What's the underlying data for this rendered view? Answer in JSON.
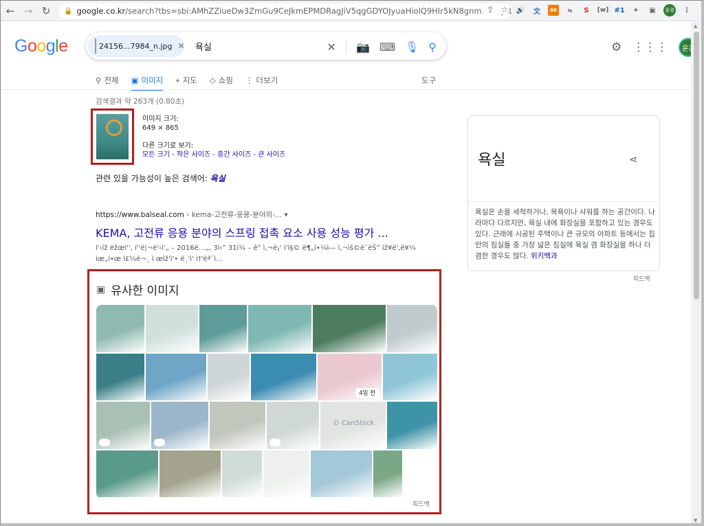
{
  "browser": {
    "url_host": "google.co.kr",
    "url_rest": "/search?tbs=sbi:AMhZZiueDw3ZmGu9CeJkmEPMDRagJiV5qgGDYOJyuaHiolQ9HIr5kN8gnmXxlFtJhLUwG5...",
    "ext_badge": "86",
    "ext_hash": "#1",
    "profile_initials": "윤경"
  },
  "header": {
    "logo_letters": [
      "G",
      "o",
      "o",
      "g",
      "l",
      "e"
    ],
    "image_chip_label": "24156...7984_n.jpg",
    "query": "욕실",
    "account_initials": "윤경"
  },
  "tabs": [
    {
      "label": "전체",
      "icon": "search-icon"
    },
    {
      "label": "이미지",
      "icon": "image-icon",
      "active": true
    },
    {
      "label": "지도",
      "icon": "map-pin-icon"
    },
    {
      "label": "쇼핑",
      "icon": "tag-icon"
    },
    {
      "label": "더보기",
      "icon": "more-vert-icon"
    }
  ],
  "tools_label": "도구",
  "stats": "검색결과 약 263개 (0.80초)",
  "query_image": {
    "size_label": "이미지 크기:",
    "size_value": "649 × 865",
    "other_sizes_label": "다른 크기로 보기:",
    "sizes_links": "모든 크기 - 작은 사이즈 - 중간 사이즈 - 큰 사이즈"
  },
  "related": {
    "prefix": "관련 있을 가능성이 높은 검색어:",
    "term": "욕실"
  },
  "result": {
    "url_host": "https://www.balseal.com",
    "url_path": " › kema-고전류-응용-분야의-... ▾",
    "title": "KEMA, 고전류 응용 분야의 스프링 접촉 요소 사용 성능 평가 ...",
    "snippet": "í'‹íž ëžœì'', í''ë¦¬ë'‹ì'„ – 2016ë…„, 3ì›” 31ì¼ – ê° ì‚¬ë¡' ì'ì§© ë¶„ì•¼ì— ì‚¬ìš©ë˜ëŠ” ìž¥ë'‚ë¥¼ ìœ„í•œ ì£¼ë¬¸ ì œìž'ì'• ë¸'ì' ì†'ëª¨ì..."
  },
  "similar": {
    "heading": "유사한 이미지",
    "badge": "4일 전",
    "watermark": "© CanStock",
    "feedback": "피드백",
    "colors": {
      "row1": [
        "#8fbab0",
        "#cfe0dd",
        "#5d9c98",
        "#7fb8b3",
        "#4d7c5f",
        "#bfcbcc"
      ],
      "row2": [
        "#3a7f88",
        "#6fa6c8",
        "#cfd6d8",
        "#3b8cb1",
        "#eac8cf",
        "#8fc6d6"
      ],
      "row3": [
        "#a9c0b5",
        "#9cb6c9",
        "#c2c7bd",
        "#cfd8d4",
        "#e2e4e2",
        "#3e93a6"
      ],
      "row4": [
        "#5a9a88",
        "#a4a48e",
        "#cfdcd8",
        "#eef0ee",
        "#a3c8d8",
        "#7aa886",
        "#ffffff"
      ]
    }
  },
  "knowledge_panel": {
    "title": "욕실",
    "description": "욕실은 손을 세척하거나, 목욕이나 샤워를 하는 공간이다. 나라마다 다르지만, 욕실 내에 화장실을 포함하고 있는 경우도 있다. 근래에 시공된 주택이나 큰 규모의 아파트 등에서는 집안의 침실들 중 가장 넓은 침실에 욕실 겸 화장실을 하나 더 겸한 경우도 많다.",
    "wiki_link": "위키백과",
    "feedback": "피드백"
  },
  "accent_colors": {
    "highlight_border": "#b71c1c",
    "link": "#1a0dab",
    "active_tab": "#1a73e8"
  }
}
